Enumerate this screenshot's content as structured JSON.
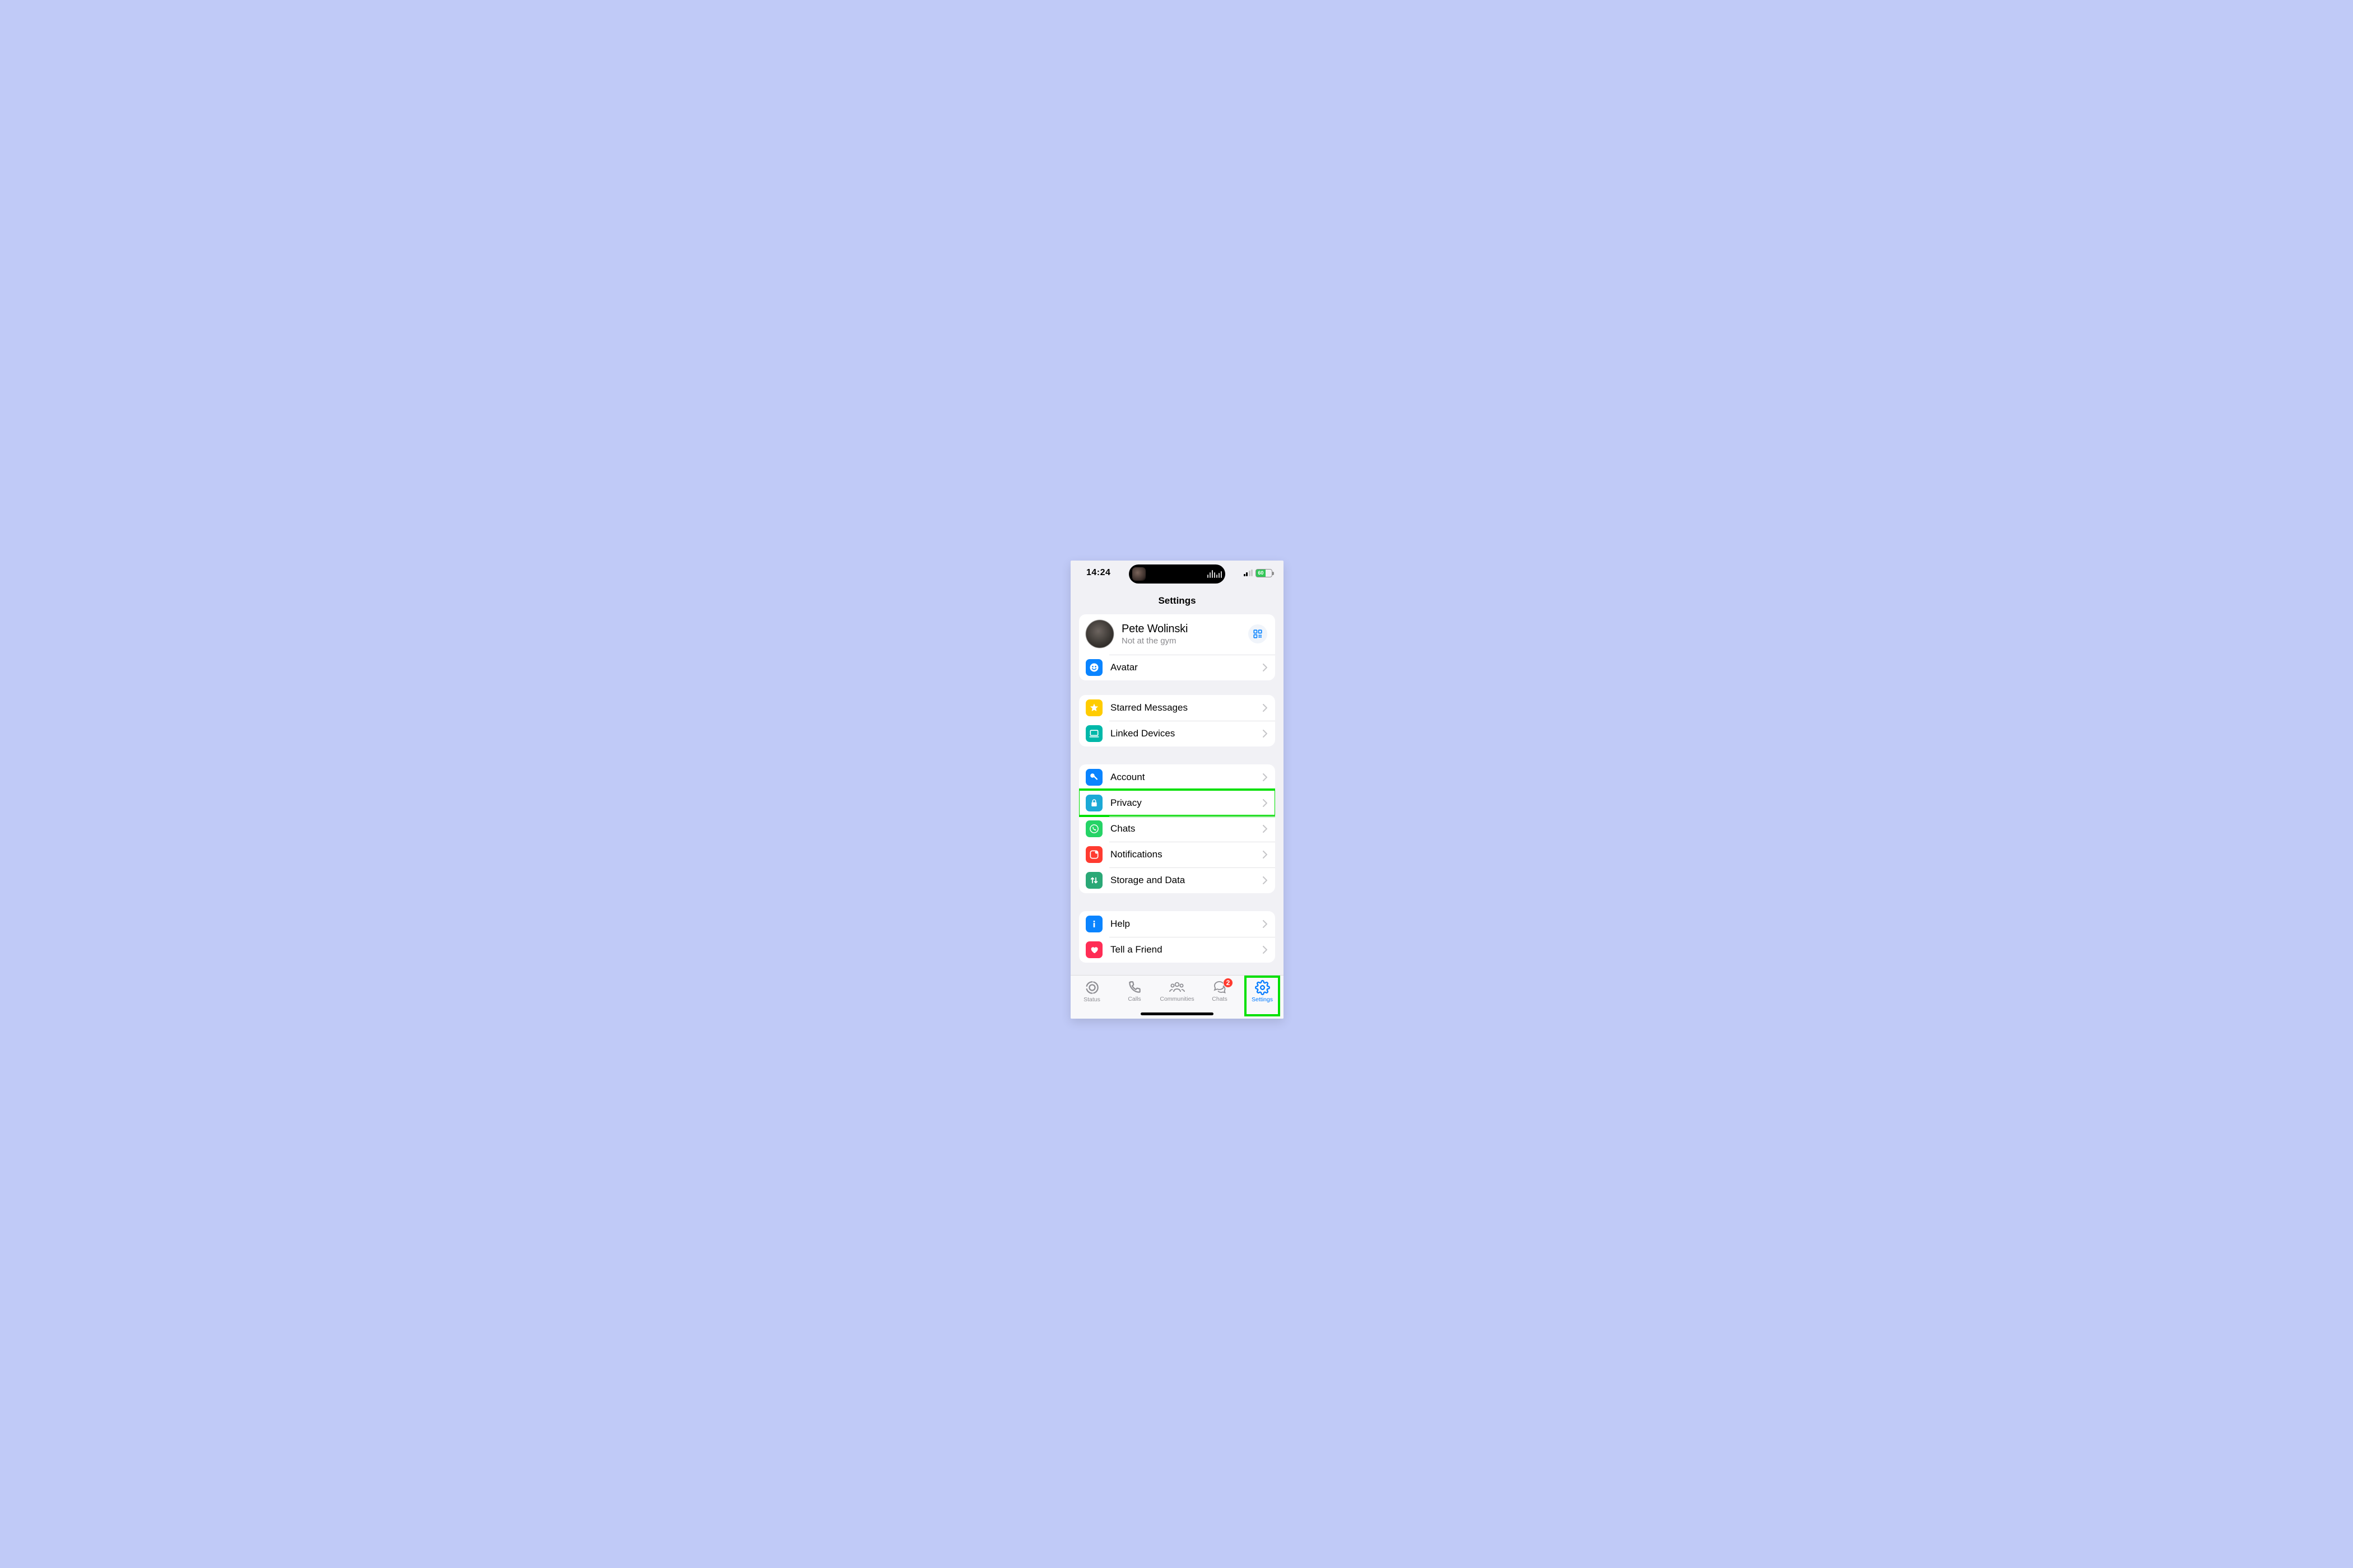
{
  "statusbar": {
    "time": "14:24",
    "battery": "60"
  },
  "header": {
    "title": "Settings"
  },
  "profile": {
    "name": "Pete Wolinski",
    "status": "Not at the gym"
  },
  "rows": {
    "avatar": "Avatar",
    "starred": "Starred Messages",
    "linked": "Linked Devices",
    "account": "Account",
    "privacy": "Privacy",
    "chats": "Chats",
    "notifications": "Notifications",
    "storage": "Storage and Data",
    "help": "Help",
    "tell": "Tell a Friend"
  },
  "tabs": {
    "status": "Status",
    "calls": "Calls",
    "communities": "Communities",
    "chats": "Chats",
    "settings": "Settings",
    "chats_badge": "2"
  },
  "highlight": {
    "row": "privacy",
    "tab": "settings"
  }
}
